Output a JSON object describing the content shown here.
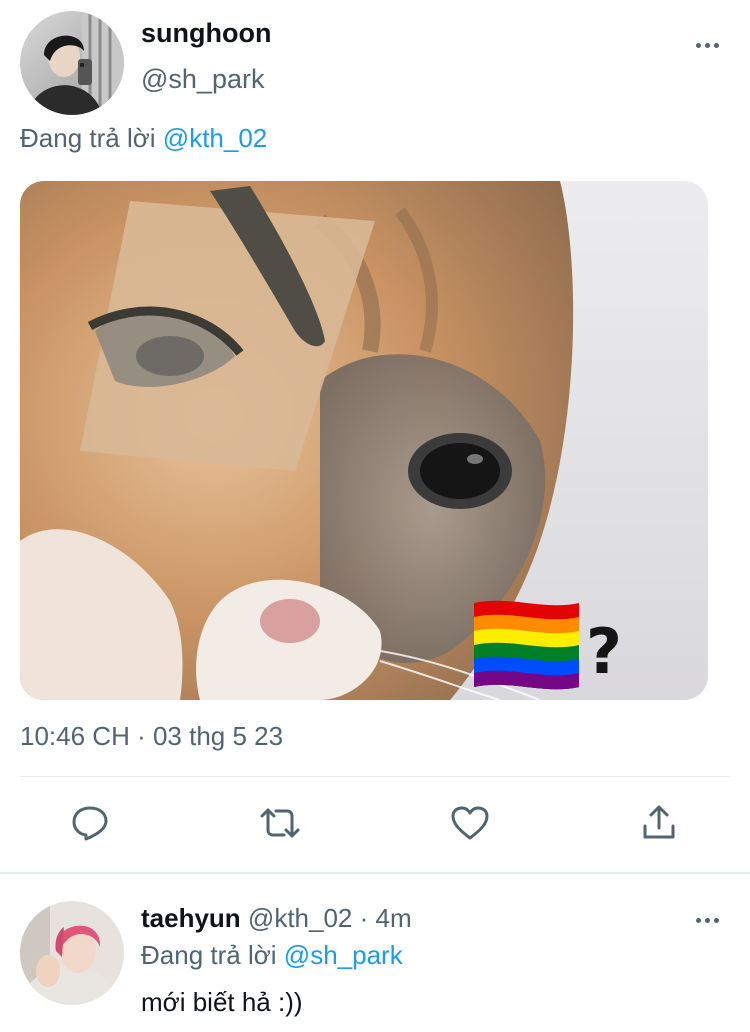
{
  "tweet": {
    "author_name": "sunghoon",
    "author_handle": "@sh_park",
    "reply_prefix": "Đang trả lời",
    "reply_to": "@kth_02",
    "image_overlay_text": "?",
    "timestamp": "10:46 CH · 03 thg 5 23",
    "actions": {
      "reply_icon": "reply-icon",
      "retweet_icon": "retweet-icon",
      "like_icon": "heart-icon",
      "share_icon": "share-icon"
    }
  },
  "reply": {
    "author_name": "taehyun",
    "author_handle": "@kth_02",
    "separator": "·",
    "time_ago": "4m",
    "reply_prefix": "Đang trả lời",
    "reply_to": "@sh_park",
    "text": "mới biết hả :))"
  },
  "colors": {
    "accent": "#1d9bf0",
    "secondary_text": "#536471",
    "divider": "#e6ecf0"
  }
}
